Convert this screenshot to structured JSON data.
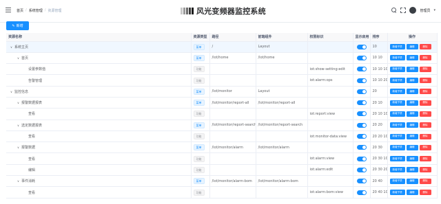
{
  "header": {
    "breadcrumb": [
      "首页",
      "系统管理",
      "资源管理"
    ],
    "title": "风光变频器监控系统",
    "user_name": "管理员",
    "colors": {
      "brand": "#1890ff",
      "danger": "#ff4949"
    }
  },
  "toolbar": {
    "add_label": "新增"
  },
  "table": {
    "headers": [
      "资源名称",
      "资源类型",
      "路径",
      "前端组件",
      "权限标识",
      "显示启用",
      "排序",
      "操作"
    ],
    "op_labels": {
      "add": "新增子项",
      "edit": "编辑",
      "delete": "删除"
    },
    "rows": [
      {
        "name": "系统主页",
        "level": 0,
        "expand": "collapse",
        "type": "菜单",
        "type_kind": "dir",
        "path": "/",
        "component": "Layout",
        "perm": "",
        "sort": "10",
        "selected": true,
        "add_child": true
      },
      {
        "name": "首页",
        "level": 1,
        "expand": "collapse",
        "type": "菜单",
        "type_kind": "dir",
        "path": "/lot/home",
        "component": "/lot/home",
        "perm": "",
        "sort": "10 10",
        "selected": false,
        "add_child": true
      },
      {
        "name": "设置参数值",
        "level": 2,
        "expand": "none",
        "type": "功能",
        "type_kind": "func",
        "path": "",
        "component": "",
        "perm": "iot:show-setting:edit",
        "sort": "10 10 10",
        "selected": false,
        "add_child": true
      },
      {
        "name": "告警管理",
        "level": 2,
        "expand": "none",
        "type": "功能",
        "type_kind": "func",
        "path": "",
        "component": "",
        "perm": "iot:alarm:ops",
        "sort": "10 10 20",
        "selected": false,
        "add_child": true
      },
      {
        "name": "监控信息",
        "level": 0,
        "expand": "collapse",
        "type": "菜单",
        "type_kind": "dir",
        "path": "/lot/monitor",
        "component": "Layout",
        "perm": "",
        "sort": "20",
        "selected": false,
        "add_child": true
      },
      {
        "name": "报警数据报表",
        "level": 1,
        "expand": "collapse",
        "type": "菜单",
        "type_kind": "dir",
        "path": "/lot/monitor/report-all",
        "component": "/lot/monitor/report-all",
        "perm": "",
        "sort": "20 10",
        "selected": false,
        "add_child": true
      },
      {
        "name": "查看",
        "level": 2,
        "expand": "none",
        "type": "功能",
        "type_kind": "func",
        "path": "",
        "component": "",
        "perm": "iot:report:view",
        "sort": "20 10 10",
        "selected": false,
        "add_child": true
      },
      {
        "name": "选定数据报表",
        "level": 1,
        "expand": "collapse",
        "type": "菜单",
        "type_kind": "dir",
        "path": "/lot/monitor/report-search",
        "component": "/lot/monitor/report-search",
        "perm": "",
        "sort": "20 20",
        "selected": false,
        "add_child": true
      },
      {
        "name": "查看",
        "level": 2,
        "expand": "none",
        "type": "功能",
        "type_kind": "func",
        "path": "",
        "component": "",
        "perm": "iot:monitor-data:view",
        "sort": "20 20 10",
        "selected": false,
        "add_child": true
      },
      {
        "name": "报警数据",
        "level": 1,
        "expand": "collapse",
        "type": "菜单",
        "type_kind": "dir",
        "path": "/lot/monitor/alarm",
        "component": "/lot/monitor/alarm",
        "perm": "",
        "sort": "20 30",
        "selected": false,
        "add_child": true
      },
      {
        "name": "查看",
        "level": 2,
        "expand": "none",
        "type": "功能",
        "type_kind": "func",
        "path": "",
        "component": "",
        "perm": "iot:alarm:view",
        "sort": "20 30 10",
        "selected": false,
        "add_child": true
      },
      {
        "name": "编辑",
        "level": 2,
        "expand": "none",
        "type": "功能",
        "type_kind": "func",
        "path": "",
        "component": "",
        "perm": "iot:alarm:edit",
        "sort": "20 30 20",
        "selected": false,
        "add_child": true
      },
      {
        "name": "事件消耗",
        "level": 1,
        "expand": "collapse",
        "type": "菜单",
        "type_kind": "dir",
        "path": "/lot/monitor/alarm-bom",
        "component": "/lot/monitor/alarm-bom",
        "perm": "",
        "sort": "20 40",
        "selected": false,
        "add_child": true
      },
      {
        "name": "查看",
        "level": 2,
        "expand": "none",
        "type": "功能",
        "type_kind": "func",
        "path": "",
        "component": "",
        "perm": "iot:alarm:bom:view",
        "sort": "20 40 10",
        "selected": false,
        "add_child": true
      }
    ]
  }
}
